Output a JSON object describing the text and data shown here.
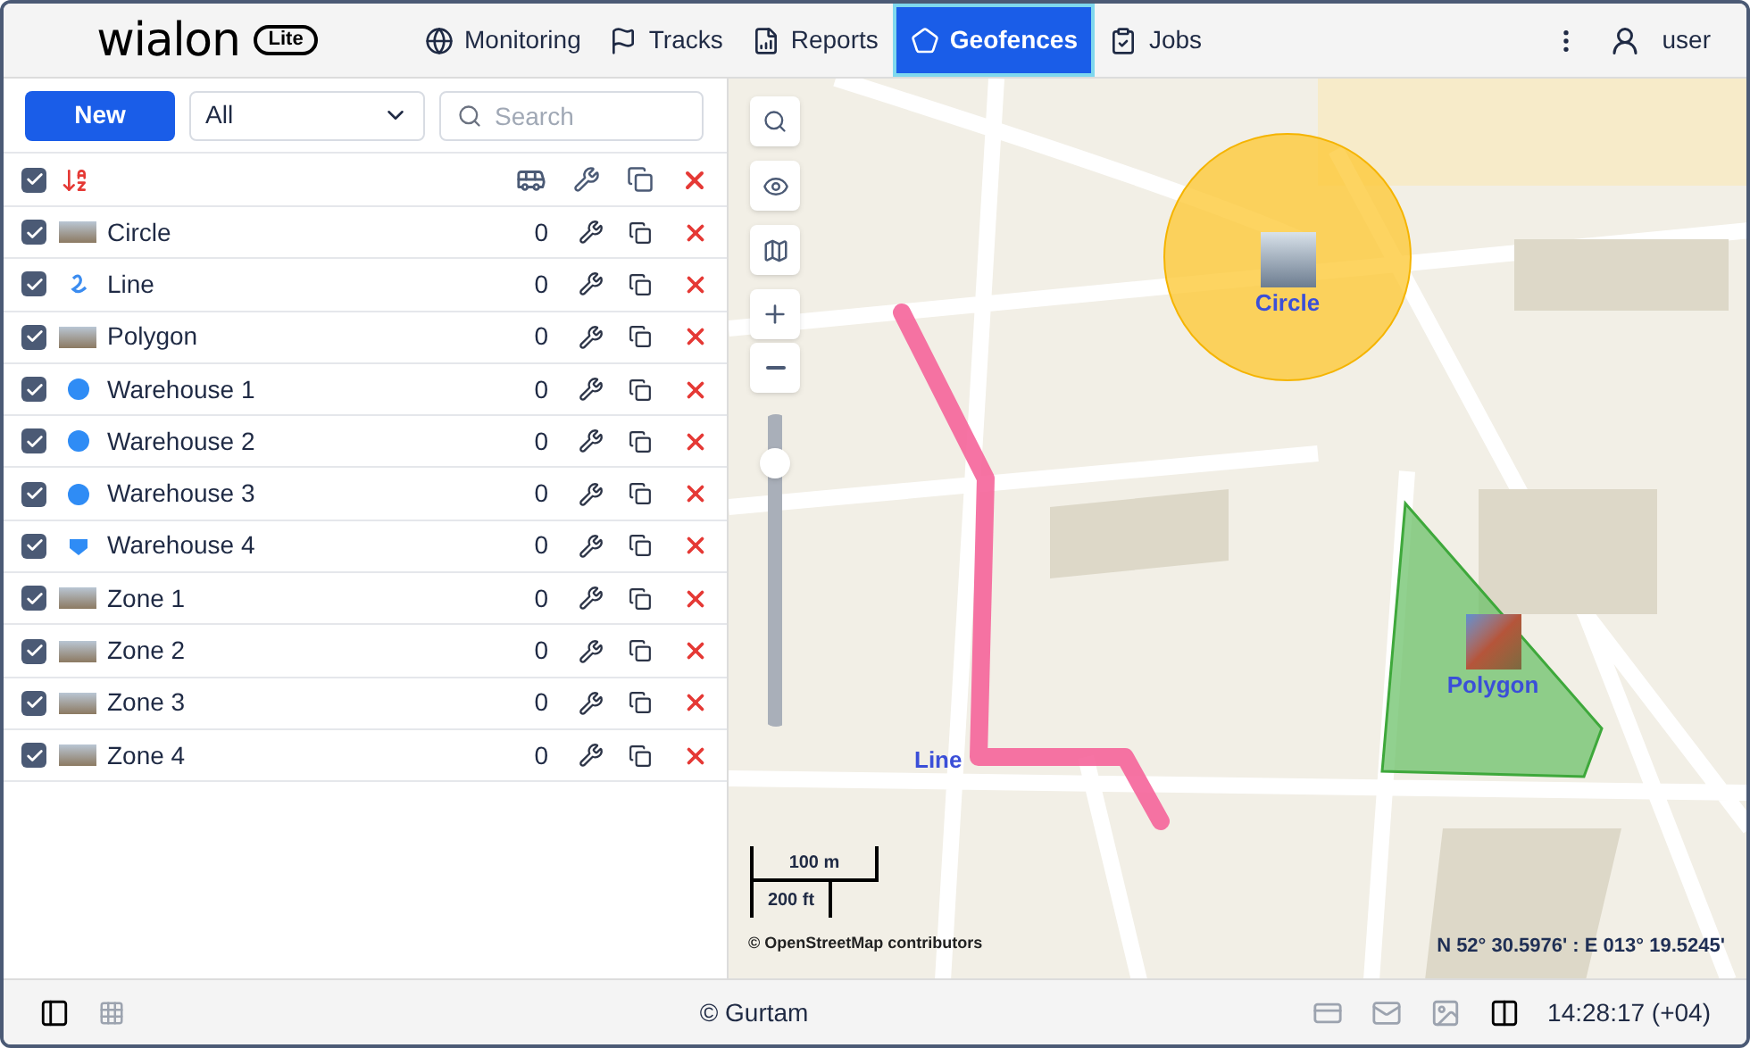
{
  "app": {
    "logo": "wialon",
    "logo_badge": "Lite"
  },
  "nav": [
    {
      "label": "Monitoring",
      "selected": false
    },
    {
      "label": "Tracks",
      "selected": false
    },
    {
      "label": "Reports",
      "selected": false
    },
    {
      "label": "Geofences",
      "selected": true
    },
    {
      "label": "Jobs",
      "selected": false
    }
  ],
  "user": {
    "name": "user"
  },
  "toolbar": {
    "new_button": "New",
    "filter": {
      "value": "All"
    },
    "search": {
      "placeholder": "Search"
    }
  },
  "list": {
    "all_checked": true,
    "rows": [
      {
        "name": "Circle",
        "count": "0",
        "checked": true,
        "kind": "photo"
      },
      {
        "name": "Line",
        "count": "0",
        "checked": true,
        "kind": "line"
      },
      {
        "name": "Polygon",
        "count": "0",
        "checked": true,
        "kind": "photo"
      },
      {
        "name": "Warehouse 1",
        "count": "0",
        "checked": true,
        "kind": "dot"
      },
      {
        "name": "Warehouse 2",
        "count": "0",
        "checked": true,
        "kind": "dot"
      },
      {
        "name": "Warehouse 3",
        "count": "0",
        "checked": true,
        "kind": "dot"
      },
      {
        "name": "Warehouse 4",
        "count": "0",
        "checked": true,
        "kind": "pentagon"
      },
      {
        "name": "Zone 1",
        "count": "0",
        "checked": true,
        "kind": "photo"
      },
      {
        "name": "Zone 2",
        "count": "0",
        "checked": true,
        "kind": "photo"
      },
      {
        "name": "Zone 3",
        "count": "0",
        "checked": true,
        "kind": "photo"
      },
      {
        "name": "Zone 4",
        "count": "0",
        "checked": true,
        "kind": "photo"
      }
    ]
  },
  "map": {
    "zoom": {
      "level": 0.88
    },
    "geofences": [
      {
        "label": "Circle",
        "kind": "circle"
      },
      {
        "label": "Line",
        "kind": "line"
      },
      {
        "label": "Polygon",
        "kind": "polygon"
      }
    ],
    "scale": {
      "metric": "100 m",
      "imperial": "200 ft"
    },
    "attribution": "© OpenStreetMap contributors",
    "coordinates": "N 52° 30.5976' : E 013° 19.5245'"
  },
  "status_bar": {
    "copyright": "© Gurtam",
    "time": "14:28:17 (+04)"
  }
}
